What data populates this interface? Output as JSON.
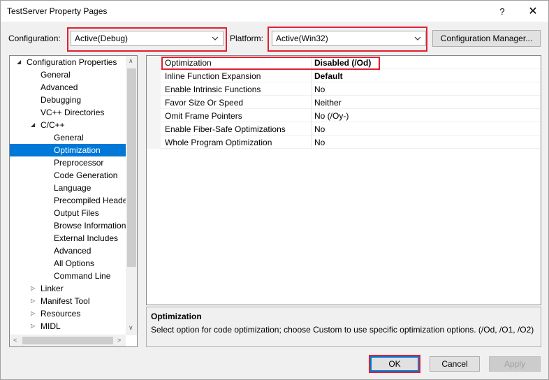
{
  "window": {
    "title": "TestServer Property Pages",
    "help_glyph": "?",
    "close_glyph": "✕"
  },
  "config_bar": {
    "configuration_label": "Configuration:",
    "configuration_value": "Active(Debug)",
    "platform_label": "Platform:",
    "platform_value": "Active(Win32)",
    "config_manager_label": "Configuration Manager..."
  },
  "tree": {
    "items": [
      {
        "label": "Configuration Properties",
        "glyph": "◢"
      },
      {
        "label": "General"
      },
      {
        "label": "Advanced"
      },
      {
        "label": "Debugging"
      },
      {
        "label": "VC++ Directories"
      },
      {
        "label": "C/C++",
        "glyph": "◢"
      },
      {
        "label": "General"
      },
      {
        "label": "Optimization",
        "selected": true
      },
      {
        "label": "Preprocessor"
      },
      {
        "label": "Code Generation"
      },
      {
        "label": "Language"
      },
      {
        "label": "Precompiled Heade"
      },
      {
        "label": "Output Files"
      },
      {
        "label": "Browse Information"
      },
      {
        "label": "External Includes"
      },
      {
        "label": "Advanced"
      },
      {
        "label": "All Options"
      },
      {
        "label": "Command Line"
      },
      {
        "label": "Linker",
        "glyph": "▷"
      },
      {
        "label": "Manifest Tool",
        "glyph": "▷"
      },
      {
        "label": "Resources",
        "glyph": "▷"
      },
      {
        "label": "MIDL",
        "glyph": "▷"
      }
    ],
    "scroll_up": "∧",
    "scroll_down": "∨",
    "scroll_left": "<",
    "scroll_right": ">"
  },
  "properties": [
    {
      "name": "Optimization",
      "value": "Disabled (/Od)",
      "bold": true
    },
    {
      "name": "Inline Function Expansion",
      "value": "Default",
      "bold": true
    },
    {
      "name": "Enable Intrinsic Functions",
      "value": "No"
    },
    {
      "name": "Favor Size Or Speed",
      "value": "Neither"
    },
    {
      "name": "Omit Frame Pointers",
      "value": "No (/Oy-)"
    },
    {
      "name": "Enable Fiber-Safe Optimizations",
      "value": "No"
    },
    {
      "name": "Whole Program Optimization",
      "value": "No"
    }
  ],
  "description": {
    "title": "Optimization",
    "text": "Select option for code optimization; choose Custom to use specific optimization options.     (/Od, /O1, /O2)"
  },
  "buttons": {
    "ok": "OK",
    "cancel": "Cancel",
    "apply": "Apply"
  },
  "colors": {
    "highlight_border": "#e0202f",
    "selection": "#0078d7"
  }
}
